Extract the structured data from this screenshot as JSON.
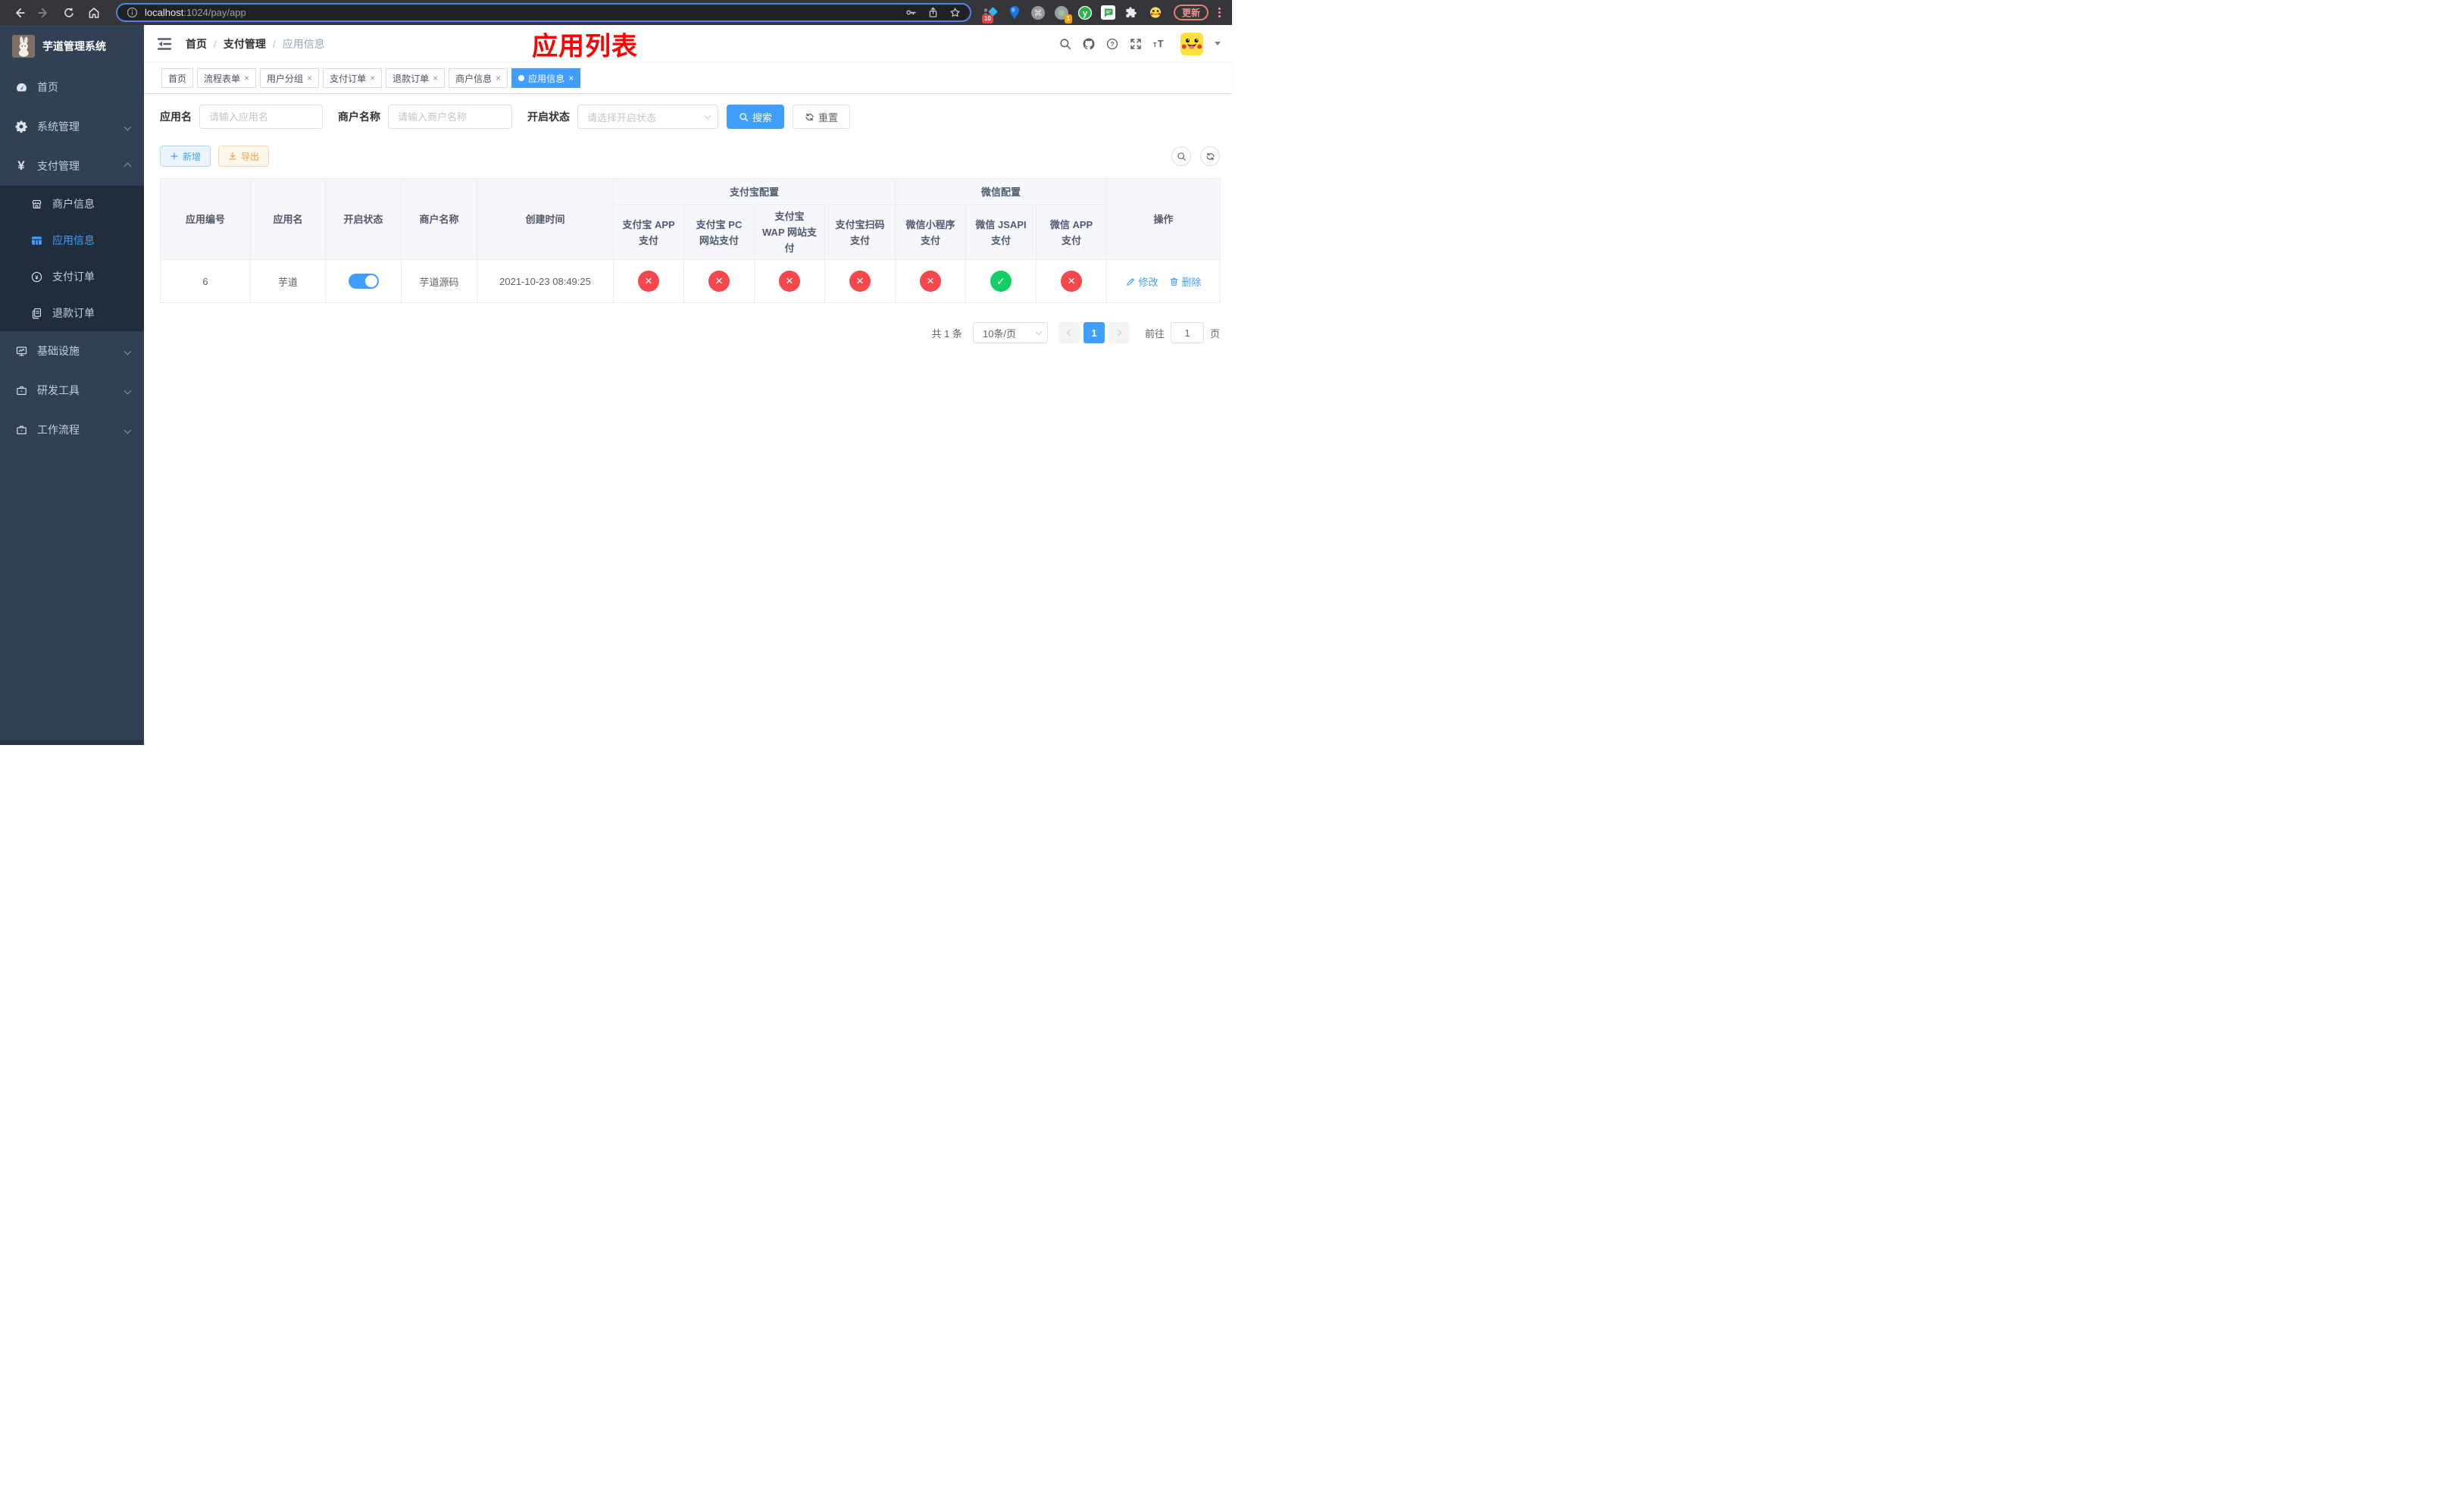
{
  "browser": {
    "url_host": "localhost",
    "url_path": ":1024/pay/app",
    "update_label": "更新",
    "ext_badge_diamond": "10",
    "ext_badge_record": "1",
    "ext_y_letter": "y"
  },
  "sidebar": {
    "title": "芋道管理系统",
    "menu_home": "首页",
    "menu_system": "系统管理",
    "menu_pay": "支付管理",
    "sub_merchant": "商户信息",
    "sub_app": "应用信息",
    "sub_order": "支付订单",
    "sub_refund": "退款订单",
    "menu_infra": "基础设施",
    "menu_dev": "研发工具",
    "menu_flow": "工作流程"
  },
  "header": {
    "breadcrumb": [
      "首页",
      "支付管理",
      "应用信息"
    ],
    "breadcrumb_sep": "/",
    "annotation": "应用列表"
  },
  "tabs": {
    "close_glyph": "×",
    "items": [
      {
        "label": "首页"
      },
      {
        "label": "流程表单"
      },
      {
        "label": "用户分组"
      },
      {
        "label": "支付订单"
      },
      {
        "label": "退款订单"
      },
      {
        "label": "商户信息"
      },
      {
        "label": "应用信息"
      }
    ]
  },
  "filters": {
    "app_name_label": "应用名",
    "app_name_placeholder": "请输入应用名",
    "merchant_label": "商户名称",
    "merchant_placeholder": "请输入商户名称",
    "status_label": "开启状态",
    "status_placeholder": "请选择开启状态",
    "search_label": "搜索",
    "reset_label": "重置"
  },
  "toolbar": {
    "add_label": "新增",
    "export_label": "导出"
  },
  "table": {
    "alipay_group": "支付宝配置",
    "wechat_group": "微信配置",
    "col_app_id": "应用编号",
    "col_app_name": "应用名",
    "col_status": "开启状态",
    "col_merchant": "商户名称",
    "col_created": "创建时间",
    "col_alipay_app": "支付宝 APP 支付",
    "col_alipay_pc": "支付宝 PC 网站支付",
    "col_alipay_wap": "支付宝 WAP 网站支付",
    "col_alipay_qr": "支付宝扫码支付",
    "col_wx_mini": "微信小程序支付",
    "col_wx_jsapi": "微信 JSAPI 支付",
    "col_wx_app": "微信 APP 支付",
    "col_ops": "操作",
    "row": {
      "app_id": "6",
      "app_name": "芋道",
      "status_on": "on",
      "merchant": "芋道源码",
      "created": "2021-10-23 08:49:25",
      "configs": [
        "no",
        "no",
        "no",
        "no",
        "no",
        "yes",
        "no"
      ],
      "edit_label": "修改",
      "delete_label": "删除"
    }
  },
  "pagination": {
    "total": "共 1 条",
    "page_size": "10条/页",
    "current_page": "1",
    "goto_label": "前往",
    "goto_value": "1",
    "page_unit": "页"
  },
  "colors": {
    "accent": "#409eff",
    "success": "#13ce66",
    "danger": "#f4484d",
    "warning": "#e6a23c",
    "annotation_red": "#fe0000",
    "sidebar_bg": "#304156"
  }
}
